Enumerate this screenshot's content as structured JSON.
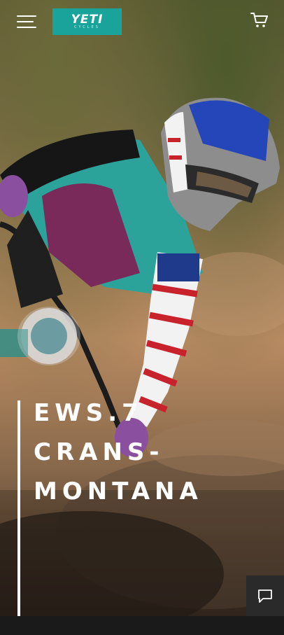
{
  "header": {
    "menu_icon": "hamburger-menu-icon",
    "logo": {
      "brand": "YETI",
      "tagline": "CYCLES"
    },
    "cart_icon": "shopping-cart-icon"
  },
  "hero": {
    "title_lines": [
      "EWS.7",
      "CRANS-",
      "MONTANA"
    ]
  },
  "chat": {
    "icon": "chat-icon"
  },
  "colors": {
    "brand_teal": "#1aa39b",
    "text": "#ffffff",
    "chat_bg": "#2a2a2a",
    "page_bg": "#1a1a1a"
  }
}
